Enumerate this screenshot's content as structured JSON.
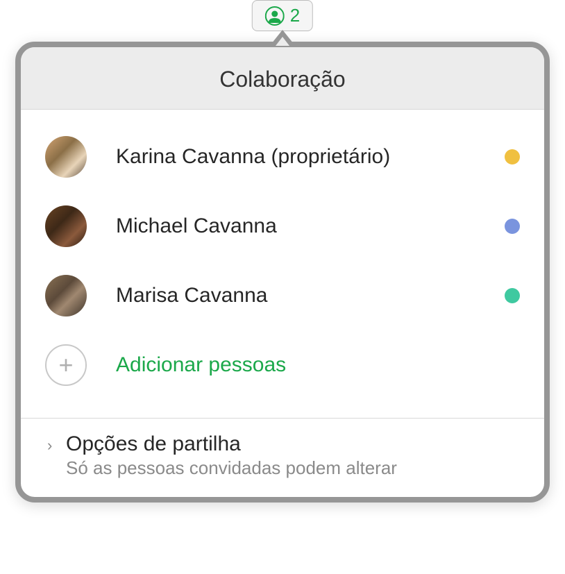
{
  "toolbar": {
    "count": "2",
    "icon_color": "#1ba84a"
  },
  "popover": {
    "title": "Colaboração"
  },
  "participants": [
    {
      "name": "Karina Cavanna (proprietário)",
      "status_color": "#f0c040"
    },
    {
      "name": "Michael Cavanna",
      "status_color": "#7a94de"
    },
    {
      "name": "Marisa Cavanna",
      "status_color": "#3fc9a0"
    }
  ],
  "add_people": {
    "label": "Adicionar pessoas"
  },
  "share_options": {
    "title": "Opções de partilha",
    "subtitle": "Só as pessoas convidadas podem alterar"
  }
}
